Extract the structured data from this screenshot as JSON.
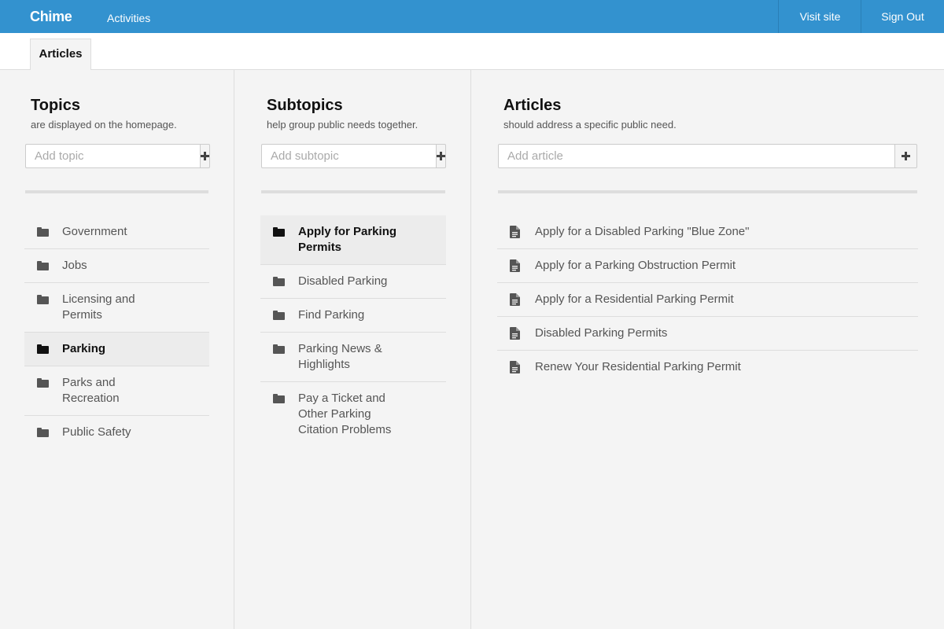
{
  "topnav": {
    "brand": "Chime",
    "activities": "Activities",
    "visit_site": "Visit site",
    "sign_out": "Sign Out",
    "color": "#3392cf"
  },
  "tabs": {
    "active": "Articles"
  },
  "topics": {
    "title": "Topics",
    "subtitle": "are displayed on the homepage.",
    "add_placeholder": "Add topic",
    "items": [
      {
        "label": "Government",
        "icon": "folder-icon"
      },
      {
        "label": "Jobs",
        "icon": "folder-icon"
      },
      {
        "label": "Licensing and Permits",
        "icon": "folder-icon"
      },
      {
        "label": "Parking",
        "icon": "folder-icon",
        "selected": true
      },
      {
        "label": "Parks and Recreation",
        "icon": "folder-icon"
      },
      {
        "label": "Public Safety",
        "icon": "folder-icon"
      }
    ]
  },
  "subtopics": {
    "title": "Subtopics",
    "subtitle": "help group public needs together.",
    "add_placeholder": "Add subtopic",
    "items": [
      {
        "label": "Apply for Parking Permits",
        "icon": "folder-icon",
        "selected": true
      },
      {
        "label": "Disabled Parking",
        "icon": "folder-icon"
      },
      {
        "label": "Find Parking",
        "icon": "folder-icon"
      },
      {
        "label": "Parking News & Highlights",
        "icon": "folder-icon"
      },
      {
        "label": "Pay a Ticket and Other Parking Citation Problems",
        "icon": "folder-icon"
      }
    ]
  },
  "articles": {
    "title": "Articles",
    "subtitle": "should address a specific public need.",
    "add_placeholder": "Add article",
    "items": [
      {
        "label": "Apply for a Disabled Parking \"Blue Zone\"",
        "icon": "file-icon"
      },
      {
        "label": "Apply for a Parking Obstruction Permit",
        "icon": "file-icon"
      },
      {
        "label": "Apply for a Residential Parking Permit",
        "icon": "file-icon"
      },
      {
        "label": "Disabled Parking Permits",
        "icon": "file-icon"
      },
      {
        "label": "Renew Your Residential Parking Permit",
        "icon": "file-icon"
      }
    ]
  }
}
